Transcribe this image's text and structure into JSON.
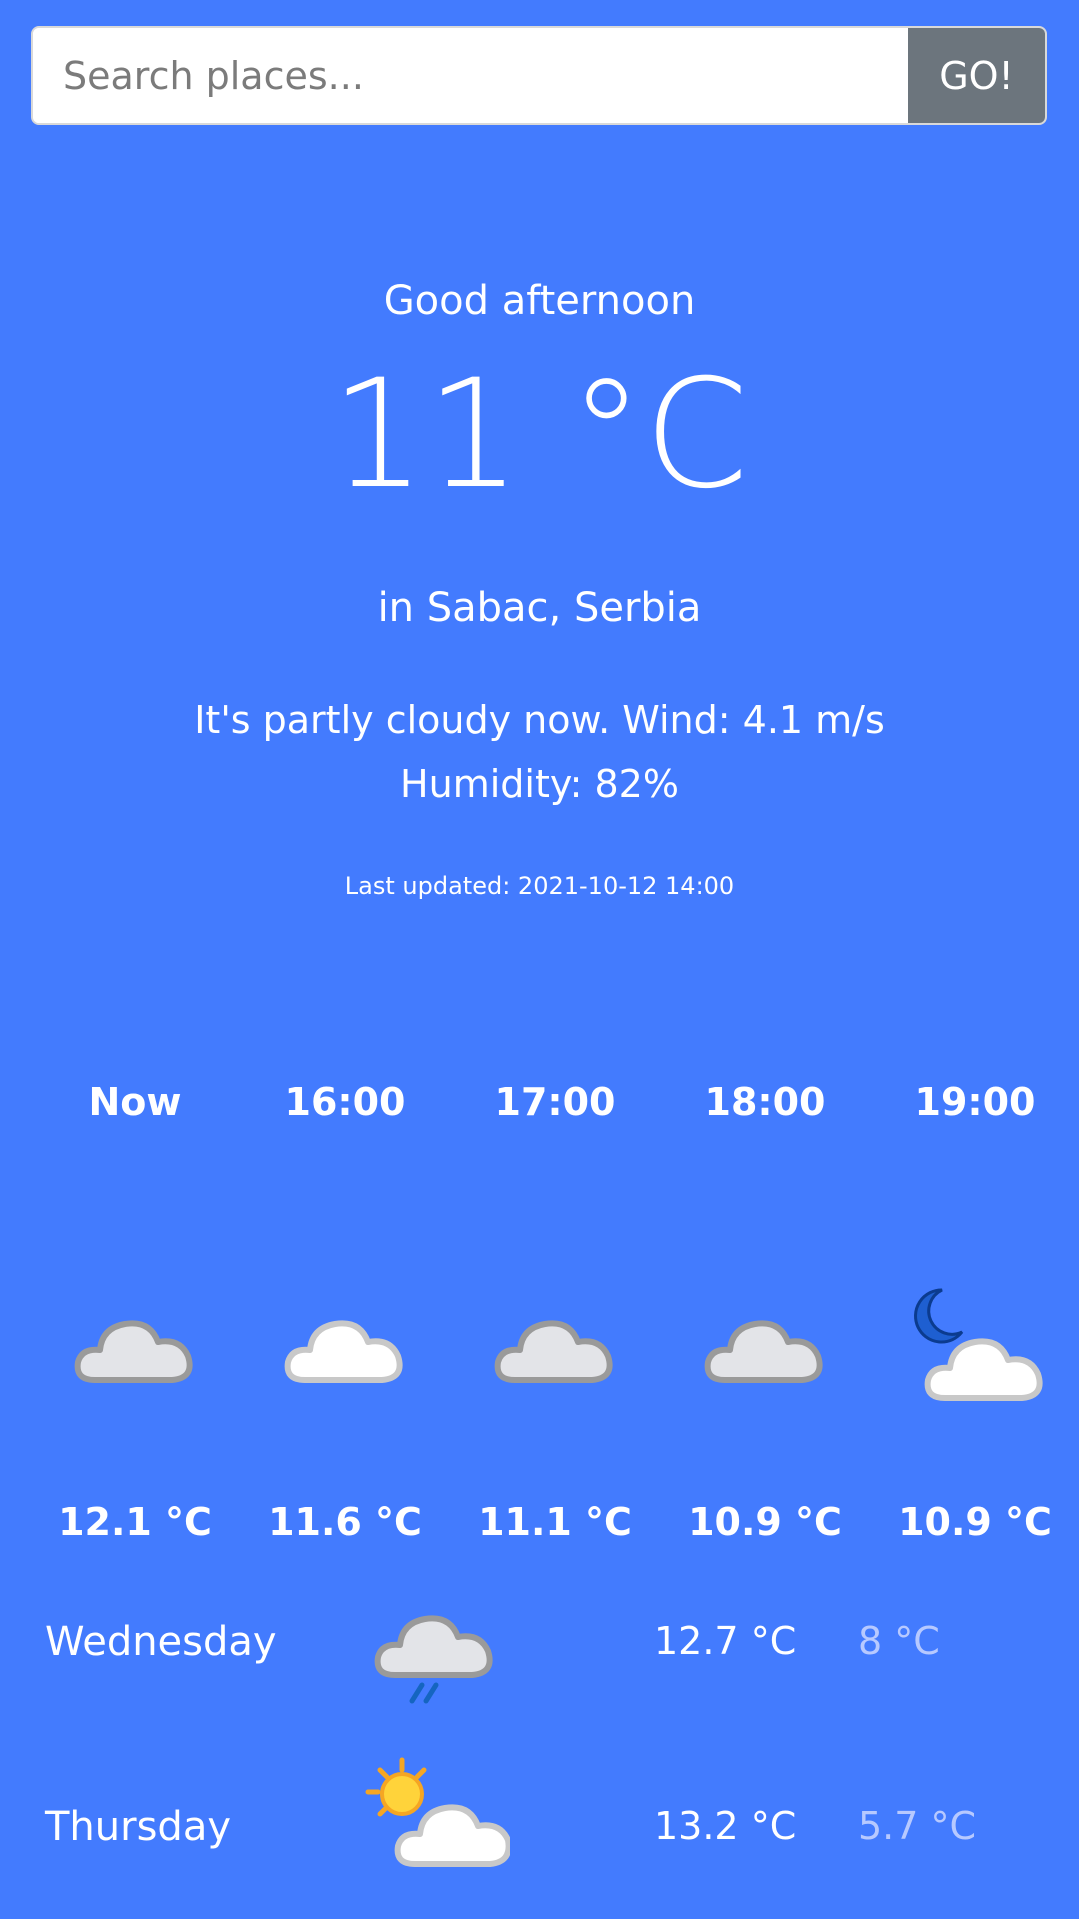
{
  "search": {
    "placeholder": "Search places...",
    "button_label": "GO!"
  },
  "current": {
    "greeting": "Good afternoon",
    "temperature": "11 °C",
    "location": "in Sabac, Serbia",
    "description_line1": "It's partly cloudy now. Wind: 4.1 m/s",
    "description_line2": "Humidity: 82%",
    "last_updated": "Last updated: 2021-10-12 14:00"
  },
  "hourly": [
    {
      "label": "Now",
      "icon": "cloud-icon",
      "temp": "12.1 °C"
    },
    {
      "label": "16:00",
      "icon": "cloud-icon",
      "temp": "11.6 °C"
    },
    {
      "label": "17:00",
      "icon": "cloud-icon",
      "temp": "11.1 °C"
    },
    {
      "label": "18:00",
      "icon": "cloud-icon",
      "temp": "10.9 °C"
    },
    {
      "label": "19:00",
      "icon": "moon-cloud-icon",
      "temp": "10.9 °C"
    }
  ],
  "daily": [
    {
      "day": "Wednesday",
      "icon": "rain-cloud-icon",
      "high": "12.7 °C",
      "low": "8 °C"
    },
    {
      "day": "Thursday",
      "icon": "sun-cloud-icon",
      "high": "13.2 °C",
      "low": "5.7 °C"
    }
  ],
  "colors": {
    "background": "#437bfe",
    "button": "#6c757d",
    "low_temp": "#b7c9ff"
  }
}
